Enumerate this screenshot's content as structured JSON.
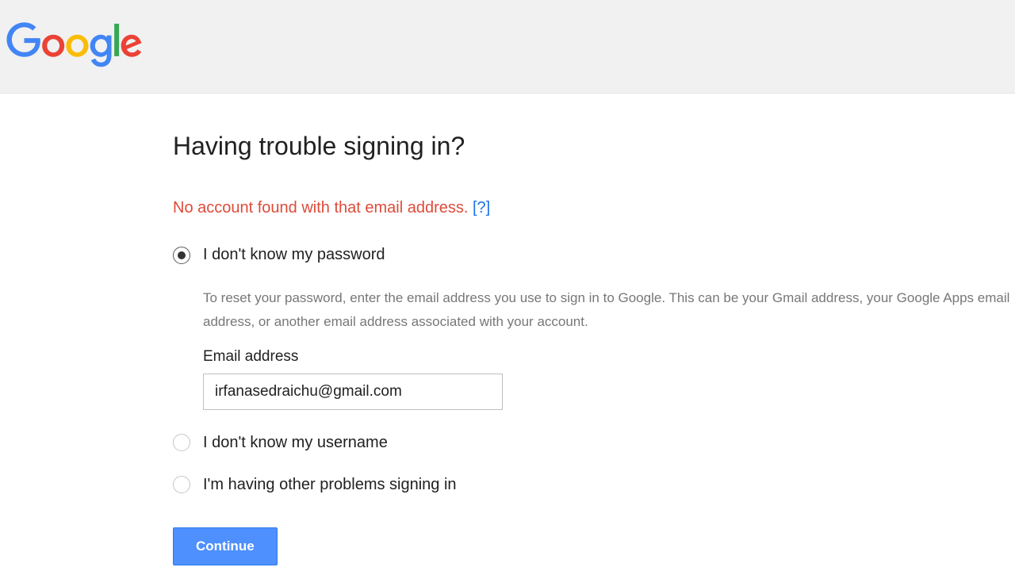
{
  "header": {
    "logo_alt": "Google"
  },
  "page": {
    "title": "Having trouble signing in?",
    "error_message": "No account found with that email address.",
    "help_link_text": "[?]"
  },
  "options": {
    "password": {
      "label": "I don't know my password",
      "description": "To reset your password, enter the email address you use to sign in to Google. This can be your Gmail address, your Google Apps email address, or another email address associated with your account.",
      "field_label": "Email address",
      "email_value": "irfanasedraichu@gmail.com",
      "selected": true
    },
    "username": {
      "label": "I don't know my username",
      "selected": false
    },
    "other": {
      "label": "I'm having other problems signing in",
      "selected": false
    }
  },
  "actions": {
    "continue_label": "Continue"
  }
}
